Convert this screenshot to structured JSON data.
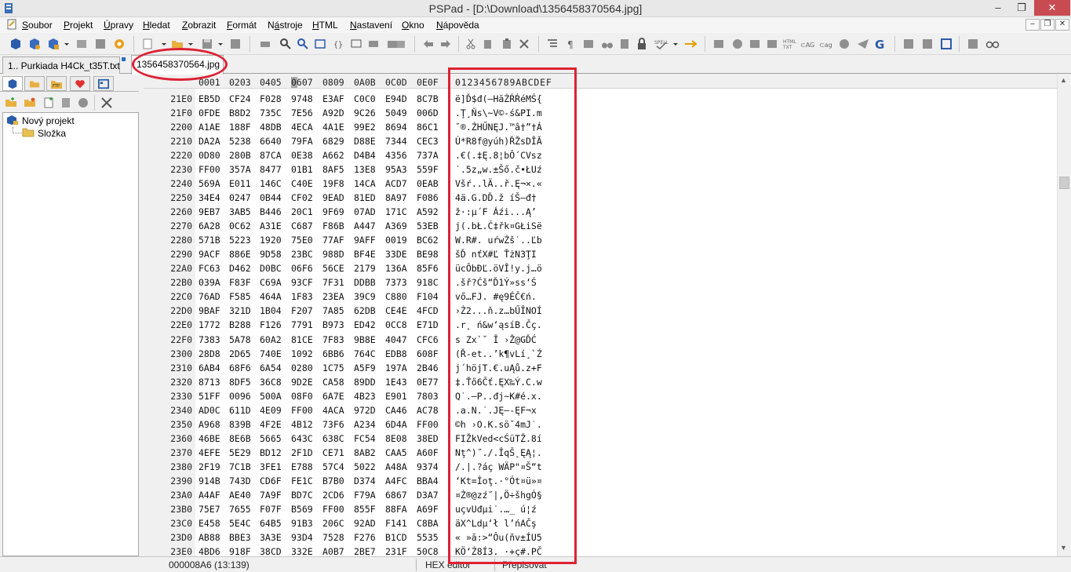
{
  "window": {
    "title": "PSPad - [D:\\Download\\1356458370564.jpg]",
    "min": "–",
    "max": "❐",
    "close": "✕"
  },
  "menu": [
    {
      "label": "Soubor",
      "hot": "S"
    },
    {
      "label": "Projekt",
      "hot": "P"
    },
    {
      "label": "Úpravy",
      "hot": "Ú"
    },
    {
      "label": "Hledat",
      "hot": "H"
    },
    {
      "label": "Zobrazit",
      "hot": "Z"
    },
    {
      "label": "Formát",
      "hot": "F"
    },
    {
      "label": "Nástroje",
      "hot": "á"
    },
    {
      "label": "HTML",
      "hot": "H"
    },
    {
      "label": "Nastavení",
      "hot": "N"
    },
    {
      "label": "Okno",
      "hot": "O"
    },
    {
      "label": "Nápověda",
      "hot": "N"
    }
  ],
  "mdi": {
    "min": "–",
    "restore": "❐",
    "close": "✕"
  },
  "tabs": [
    {
      "label": "1.. Purkiada H4Ck_t35T.txt",
      "active": false
    },
    {
      "label": "1356458370564.jpg",
      "active": true
    }
  ],
  "tree": {
    "project": "Nový projekt",
    "folder": "Složka"
  },
  "hex": {
    "header_hex": [
      "0001",
      "0203",
      "0405",
      "0607",
      "0809",
      "0A0B",
      "0C0D",
      "0E0F"
    ],
    "header_ascii": "0123456789ABCDEF",
    "rows": [
      {
        "addr": "21E0",
        "hex": [
          "EB5D",
          "CF24",
          "F028",
          "9748",
          "E3AF",
          "C0C0",
          "E94D",
          "8C7B"
        ],
        "ascii": "ë]Ď$đ(—HăŻŔŔéMŚ{"
      },
      {
        "addr": "21F0",
        "hex": [
          "0FDE",
          "B8D2",
          "735C",
          "7E56",
          "A92D",
          "9C26",
          "5049",
          "006D"
        ],
        "ascii": ".Ţ¸Ňs\\~V©-ś&PI.m"
      },
      {
        "addr": "2200",
        "hex": [
          "A1AE",
          "188F",
          "48DB",
          "4ECA",
          "4A1E",
          "99E2",
          "8694",
          "86C1"
        ],
        "ascii": "˘®.ŹHŰNĘJ.™â†”†Á"
      },
      {
        "addr": "2210",
        "hex": [
          "DA2A",
          "5238",
          "6640",
          "79FA",
          "6829",
          "D88E",
          "7344",
          "CEC3"
        ],
        "ascii": "Ú*R8f@yúh)ŘŽsDÎĂ"
      },
      {
        "addr": "2220",
        "hex": [
          "0D80",
          "280B",
          "87CA",
          "0E38",
          "A662",
          "D4B4",
          "4356",
          "737A"
        ],
        "ascii": ".€(.‡Ę.8¦bÔ´CVsz"
      },
      {
        "addr": "2230",
        "hex": [
          "FF00",
          "357A",
          "8477",
          "01B1",
          "8AF5",
          "13E8",
          "95A3",
          "559F"
        ],
        "ascii": "˙.5z„w.±Šő.č•ŁUź"
      },
      {
        "addr": "2240",
        "hex": [
          "569A",
          "E011",
          "146C",
          "C40E",
          "19F8",
          "14CA",
          "ACD7",
          "0EAB"
        ],
        "ascii": "Všŕ..lÄ..ř.Ę¬×.«"
      },
      {
        "addr": "2250",
        "hex": [
          "34E4",
          "0247",
          "0B44",
          "CF02",
          "9EAD",
          "81ED",
          "8A97",
          "F086"
        ],
        "ascii": "4ä.G.DĎ.ž­ íŠ—đ†"
      },
      {
        "addr": "2260",
        "hex": [
          "9EB7",
          "3AB5",
          "B446",
          "20C1",
          "9F69",
          "07AD",
          "171C",
          "A592"
        ],
        "ascii": "ž·:µ´F Áźi.­..Ą’"
      },
      {
        "addr": "2270",
        "hex": [
          "6A28",
          "0C62",
          "A31E",
          "C687",
          "F86B",
          "A447",
          "A369",
          "53EB"
        ],
        "ascii": "j(.bŁ.Ć‡řk¤GŁiSë"
      },
      {
        "addr": "2280",
        "hex": [
          "571B",
          "5223",
          "1920",
          "75E0",
          "77AF",
          "9AFF",
          "0019",
          "BC62"
        ],
        "ascii": "W.R#. uŕwŻš˙..Ľb"
      },
      {
        "addr": "2290",
        "hex": [
          "9ACF",
          "886E",
          "9D58",
          "23BC",
          "988D",
          "BF4E",
          "33DE",
          "BE98"
        ],
        "ascii": "šĎ nťX#Ľ ŤżN3ŢI"
      },
      {
        "addr": "22A0",
        "hex": [
          "FC63",
          "D462",
          "D0BC",
          "06F6",
          "56CE",
          "2179",
          "136A",
          "85F6"
        ],
        "ascii": "ücÔbĐĽ.öVÎ!y.j…ö"
      },
      {
        "addr": "22B0",
        "hex": [
          "039A",
          "F83F",
          "C69A",
          "93CF",
          "7F31",
          "DDBB",
          "7373",
          "918C"
        ],
        "ascii": ".šř?Ćš“Ď1Ý»ss‘Ś"
      },
      {
        "addr": "22C0",
        "hex": [
          "76AD",
          "F585",
          "464A",
          "1F83",
          "23EA",
          "39C9",
          "C880",
          "F104"
        ],
        "ascii": "v­ő…FJ. #ę9ÉČ€ń."
      },
      {
        "addr": "22D0",
        "hex": [
          "9BAF",
          "321D",
          "1B04",
          "F207",
          "7A85",
          "62DB",
          "CE4E",
          "4FCD"
        ],
        "ascii": "›Ż2...ň.z…bŰÎNOÍ"
      },
      {
        "addr": "22E0",
        "hex": [
          "1772",
          "B288",
          "F126",
          "7791",
          "B973",
          "ED42",
          "0CC8",
          "E71D"
        ],
        "ascii": ".r˛ ń&w‘ąsíB.Čç."
      },
      {
        "addr": "22F0",
        "hex": [
          "7383",
          "5A78",
          "60A2",
          "81CE",
          "7F83",
          "9B8E",
          "4047",
          "CFC6"
        ],
        "ascii": "s Zx`˘ Î ›Ž@GĎĆ"
      },
      {
        "addr": "2300",
        "hex": [
          "28D8",
          "2D65",
          "740E",
          "1092",
          "6BB6",
          "764C",
          "EDB8",
          "608F"
        ],
        "ascii": "(Ř-et..’k¶vLí¸`Ź"
      },
      {
        "addr": "2310",
        "hex": [
          "6AB4",
          "68F6",
          "6A54",
          "0280",
          "1C75",
          "A5F9",
          "197A",
          "2B46"
        ],
        "ascii": "j´höjT.€.uĄů.z+F"
      },
      {
        "addr": "2320",
        "hex": [
          "8713",
          "8DF5",
          "36C8",
          "9D2E",
          "CA58",
          "89DD",
          "1E43",
          "0E77"
        ],
        "ascii": "‡.Ťő6Čť.ĘX‰Ý.C.w"
      },
      {
        "addr": "2330",
        "hex": [
          "51FF",
          "0096",
          "500A",
          "08F0",
          "6A7E",
          "4B23",
          "E901",
          "7803"
        ],
        "ascii": "Q˙.–P..đj~K#é.x."
      },
      {
        "addr": "2340",
        "hex": [
          "AD0C",
          "611D",
          "4E09",
          "FF00",
          "4ACA",
          "972D",
          "CA46",
          "AC78"
        ],
        "ascii": "­.a.N.˙.JĘ—-ĘF¬x"
      },
      {
        "addr": "2350",
        "hex": [
          "A968",
          "839B",
          "4F2E",
          "4B12",
          "73F6",
          "A234",
          "6D4A",
          "FF00"
        ],
        "ascii": "©h ›O.K.sö˘4mJ˙."
      },
      {
        "addr": "2360",
        "hex": [
          "46BE",
          "8E6B",
          "5665",
          "643C",
          "638C",
          "FC54",
          "8E08",
          "38ED"
        ],
        "ascii": "FIŽkVed<cŚüTŽ.8í"
      },
      {
        "addr": "2370",
        "hex": [
          "4EFE",
          "5E29",
          "BD12",
          "2F1D",
          "CE71",
          "8AB2",
          "CAA5",
          "A60F"
        ],
        "ascii": "Nţ^)˝./.ÎqŠ˛ĘĄ¦."
      },
      {
        "addr": "2380",
        "hex": [
          "2F19",
          "7C1B",
          "3FE1",
          "E788",
          "57C4",
          "5022",
          "A48A",
          "9374"
        ],
        "ascii": "/.|.?áç WÄP\"¤Š“t"
      },
      {
        "addr": "2390",
        "hex": [
          "914B",
          "743D",
          "CD6F",
          "FE1C",
          "B7B0",
          "D374",
          "A4FC",
          "BBA4"
        ],
        "ascii": "‘Kt=Íoţ.·°Ót¤ü»¤"
      },
      {
        "addr": "23A0",
        "hex": [
          "A4AF",
          "AE40",
          "7A9F",
          "BD7C",
          "2CD6",
          "F79A",
          "6867",
          "D3A7"
        ],
        "ascii": "¤Ż®@zź˝|,Ö÷šhgÓ§"
      },
      {
        "addr": "23B0",
        "hex": [
          "75E7",
          "7655",
          "F07F",
          "B569",
          "FF00",
          "855F",
          "88FA",
          "A69F"
        ],
        "ascii": "uçvUđµi˙.…_ ú¦ź"
      },
      {
        "addr": "23C0",
        "hex": [
          "E458",
          "5E4C",
          "64B5",
          "91B3",
          "206C",
          "92AD",
          "F141",
          "C8BA"
        ],
        "ascii": "äX^Ldµ‘ł l’­ńAČş"
      },
      {
        "addr": "23D0",
        "hex": [
          "AB88",
          "BBE3",
          "3A3E",
          "93D4",
          "7528",
          "F276",
          "B1CD",
          "5535"
        ],
        "ascii": "« »ă:>“Ôu(ňv±ÍU5"
      },
      {
        "addr": "23E0",
        "hex": [
          "4BD6",
          "918F",
          "38CD",
          "332E",
          "A0B7",
          "2BE7",
          "231F",
          "50C8"
        ],
        "ascii": "KÖ‘Ź8Í3. ·+ç#.PČ"
      }
    ]
  },
  "status": {
    "position": "000008A6  (13:139)",
    "mode": "HEX editor",
    "overwrite": "Přepisovat"
  },
  "colors": {
    "annotation": "#dd2233",
    "accent": "#2a6cc8"
  },
  "icons": {
    "toolbar": [
      "project-icon",
      "open-project-icon",
      "save-project-icon",
      "dropdown-icon",
      "recent-icon",
      "close-project-icon",
      "settings-icon",
      "new-file-icon",
      "open-file-icon",
      "save-file-icon",
      "save-all-icon",
      "print-icon",
      "search-icon",
      "replace-icon",
      "preview-icon",
      "code-icon",
      "comment-icon",
      "email-icon",
      "undo-icon",
      "redo-icon",
      "cut-icon",
      "copy-icon",
      "paste-icon",
      "delete-icon",
      "indent-icon",
      "pilcrow-icon",
      "block-icon",
      "bookmark-icon",
      "binoculars-icon",
      "lock-icon",
      "spell-icon",
      "macro-icon",
      "toggle-icon",
      "html-icon",
      "tag-icon",
      "tag2-icon",
      "circle-icon",
      "send-icon",
      "filter-icon",
      "google-icon",
      "panel-icon",
      "layout-icon",
      "window-icon",
      "frame-icon",
      "glasses-icon"
    ]
  }
}
